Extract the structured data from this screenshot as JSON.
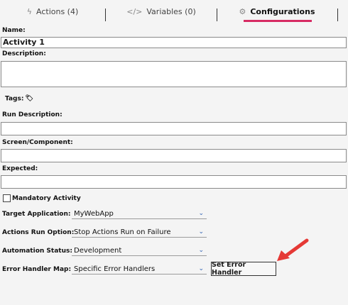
{
  "tabs": [
    {
      "label": "Actions (4)",
      "icon": "bolt-icon"
    },
    {
      "label": "Variables (0)",
      "icon": "code-icon"
    },
    {
      "label": "Configurations",
      "icon": "gear-icon"
    }
  ],
  "form": {
    "name_label": "Name:",
    "name_value": "Activity 1",
    "description_label": "Description:",
    "description_value": "",
    "tags_label": "Tags:",
    "run_description_label": "Run Description:",
    "run_description_value": "",
    "screen_component_label": "Screen/Component:",
    "screen_component_value": "",
    "expected_label": "Expected:",
    "expected_value": "",
    "mandatory_label": "Mandatory Activity",
    "target_application_label": "Target Application:",
    "target_application_value": "MyWebApp",
    "actions_run_option_label": "Actions Run Option:",
    "actions_run_option_value": "Stop Actions Run on Failure",
    "automation_status_label": "Automation Status:",
    "automation_status_value": "Development",
    "error_handler_map_label": "Error Handler Map:",
    "error_handler_map_value": "Specific Error Handlers",
    "set_error_handler_button": "Set Error Handler"
  },
  "colors": {
    "accent_underline": "#d72b63",
    "annotation_arrow": "#e53935",
    "chevron": "#2b5fb3"
  }
}
